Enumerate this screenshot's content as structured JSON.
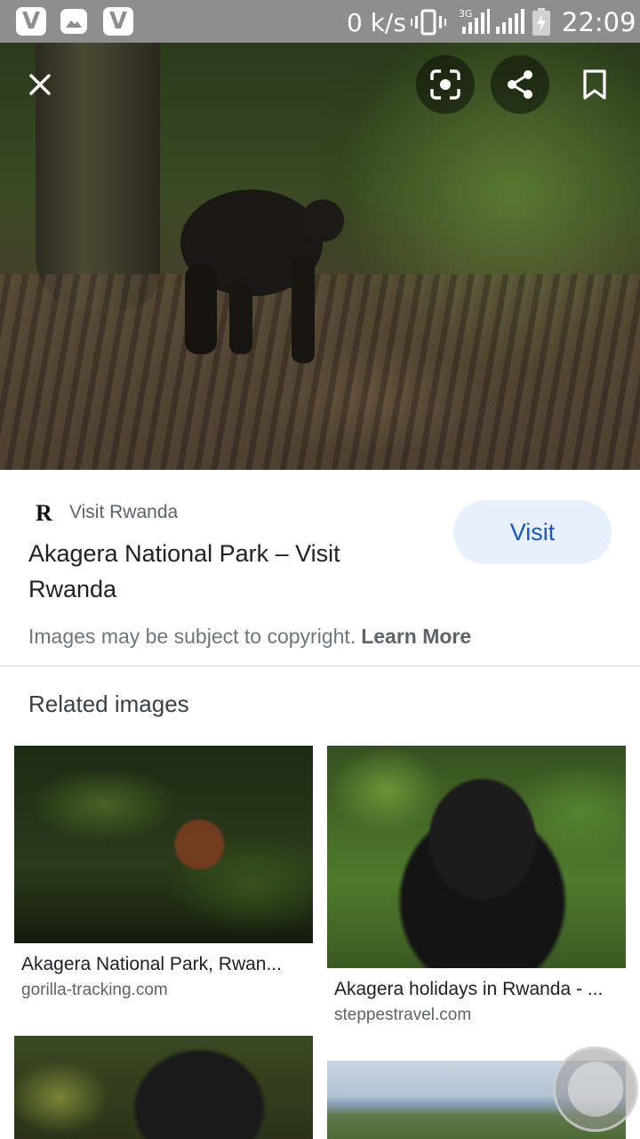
{
  "status_bar": {
    "speed": "0 k/s",
    "network": "3G",
    "time": "22:09",
    "app_icons": [
      "vivaldi-icon",
      "gallery-icon",
      "vivaldi-icon"
    ]
  },
  "viewer": {
    "close_icon": "close-icon",
    "lens_icon": "lens-icon",
    "share_icon": "share-icon",
    "save_icon": "bookmark-icon"
  },
  "source": {
    "logo": "R",
    "name": "Visit Rwanda"
  },
  "result": {
    "title": "Akagera National Park – Visit Rwanda",
    "visit_label": "Visit",
    "copyright_text": "Images may be subject to copyright.",
    "learn_more": "Learn More"
  },
  "related": {
    "heading": "Related images",
    "items": [
      {
        "caption": "Akagera National Park, Rwan...",
        "domain": "gorilla-tracking.com"
      },
      {
        "caption": "Akagera holidays in Rwanda - ...",
        "domain": "steppestravel.com"
      }
    ]
  },
  "colors": {
    "status_bar": "#8e8e8e",
    "visit_bg": "#e8f0fe",
    "visit_text": "#1a56c4"
  }
}
